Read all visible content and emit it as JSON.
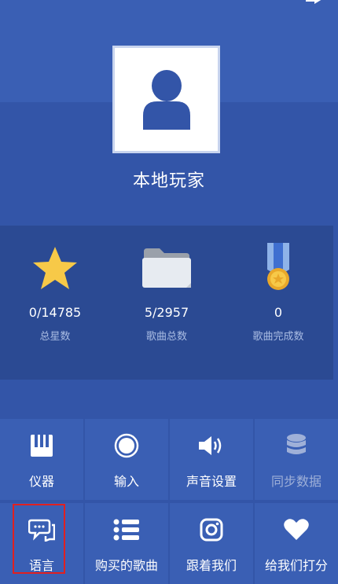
{
  "profile": {
    "name": "本地玩家"
  },
  "stats": [
    {
      "icon": "star-icon",
      "value": "0/14785",
      "label": "总星数"
    },
    {
      "icon": "folder-icon",
      "value": "5/2957",
      "label": "歌曲总数"
    },
    {
      "icon": "medal-icon",
      "value": "0",
      "label": "歌曲完成数"
    }
  ],
  "menu": [
    {
      "icon": "piano-icon",
      "label": "仪器",
      "enabled": true
    },
    {
      "icon": "record-icon",
      "label": "输入",
      "enabled": true
    },
    {
      "icon": "speaker-icon",
      "label": "声音设置",
      "enabled": true
    },
    {
      "icon": "database-icon",
      "label": "同步数据",
      "enabled": false
    },
    {
      "icon": "chat-bubble-icon",
      "label": "语言",
      "enabled": true
    },
    {
      "icon": "list-icon",
      "label": "购买的歌曲",
      "enabled": true
    },
    {
      "icon": "instagram-icon",
      "label": "跟着我们",
      "enabled": true
    },
    {
      "icon": "heart-icon",
      "label": "给我们打分",
      "enabled": true
    }
  ],
  "colors": {
    "background": "#3355a8",
    "panel": "#2b4a93",
    "tile": "#3a5fb4",
    "star": "#f7c948",
    "highlight": "#e02020"
  }
}
